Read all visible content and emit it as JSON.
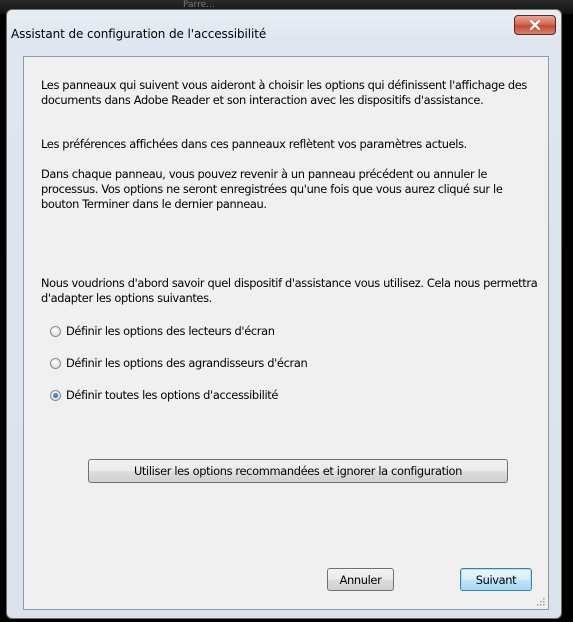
{
  "background": {
    "text": "Parre..."
  },
  "window": {
    "title": "Assistant de configuration de l'accessibilité"
  },
  "content": {
    "paragraphs": [
      "Les panneaux qui suivent vous aideront à choisir les options qui définissent l'affichage des documents dans Adobe Reader et son interaction avec les dispositifs d'assistance.",
      "Les préférences affichées dans ces panneaux reflètent vos paramètres actuels.",
      "Dans chaque panneau, vous pouvez revenir à un panneau précédent ou annuler le processus. Vos options ne seront enregistrées qu'une fois que vous aurez cliqué sur le bouton Terminer dans le dernier panneau.",
      "Nous voudrions d'abord savoir quel dispositif d'assistance vous utilisez. Cela nous permettra d'adapter les options suivantes."
    ],
    "options": [
      {
        "label": "Définir les options des lecteurs d'écran",
        "selected": false
      },
      {
        "label": "Définir les options des agrandisseurs d'écran",
        "selected": false
      },
      {
        "label": "Définir toutes les options d'accessibilité",
        "selected": true
      }
    ],
    "recommended_button": "Utiliser les options recommandées et ignorer la configuration"
  },
  "footer": {
    "cancel_label": "Annuler",
    "next_label": "Suivant"
  },
  "colors": {
    "close_button": "#c24a32",
    "default_button_border": "#3c7fb1",
    "client_background": "#f0f0f0"
  }
}
